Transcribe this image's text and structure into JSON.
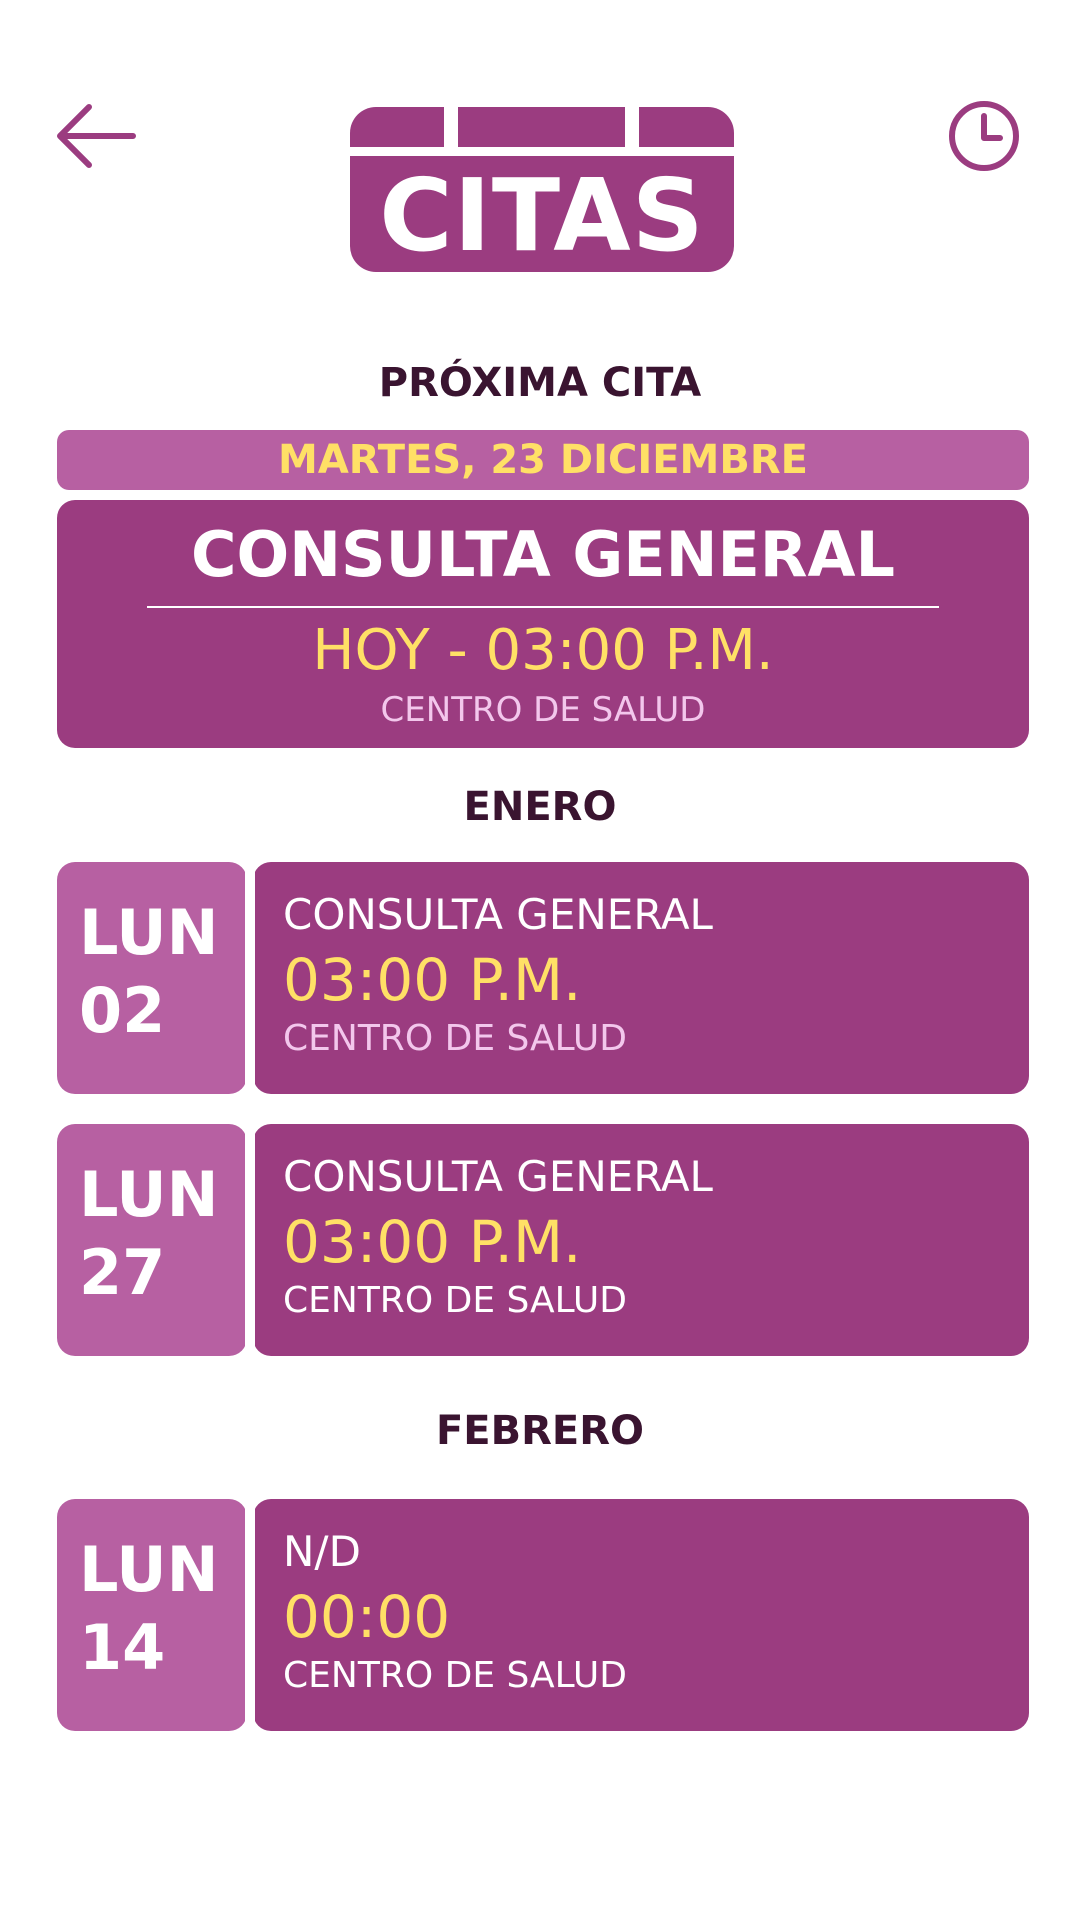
{
  "header": {
    "logo_text": "CITAS",
    "back_icon": "arrow-left-icon",
    "history_icon": "clock-icon"
  },
  "next_appointment": {
    "section_label": "PRÓXIMA CITA",
    "date": "MARTES, 23 DICIEMBRE",
    "title": "CONSULTA GENERAL",
    "time": "HOY - 03:00 P.M.",
    "place": "CENTRO DE SALUD"
  },
  "months": [
    {
      "name": "ENERO",
      "appointments": [
        {
          "day": "LUN",
          "date": "02",
          "title": "CONSULTA GENERAL",
          "time": "03:00 P.M.",
          "place": "CENTRO DE SALUD",
          "place_color": "#f3c7ec"
        },
        {
          "day": "LUN",
          "date": "27",
          "title": "CONSULTA GENERAL",
          "time": "03:00 P.M.",
          "place": "CENTRO DE SALUD",
          "place_color": "#ffffff"
        }
      ]
    },
    {
      "name": "FEBRERO",
      "appointments": [
        {
          "day": "LUN",
          "date": "14",
          "title": "N/D",
          "time": "00:00",
          "place": "CENTRO DE SALUD",
          "place_color": "#ffffff"
        }
      ]
    }
  ],
  "colors": {
    "primary": "#9b3c80",
    "secondary": "#b760a2",
    "accent": "#ffe066",
    "heading": "#3a1430"
  }
}
